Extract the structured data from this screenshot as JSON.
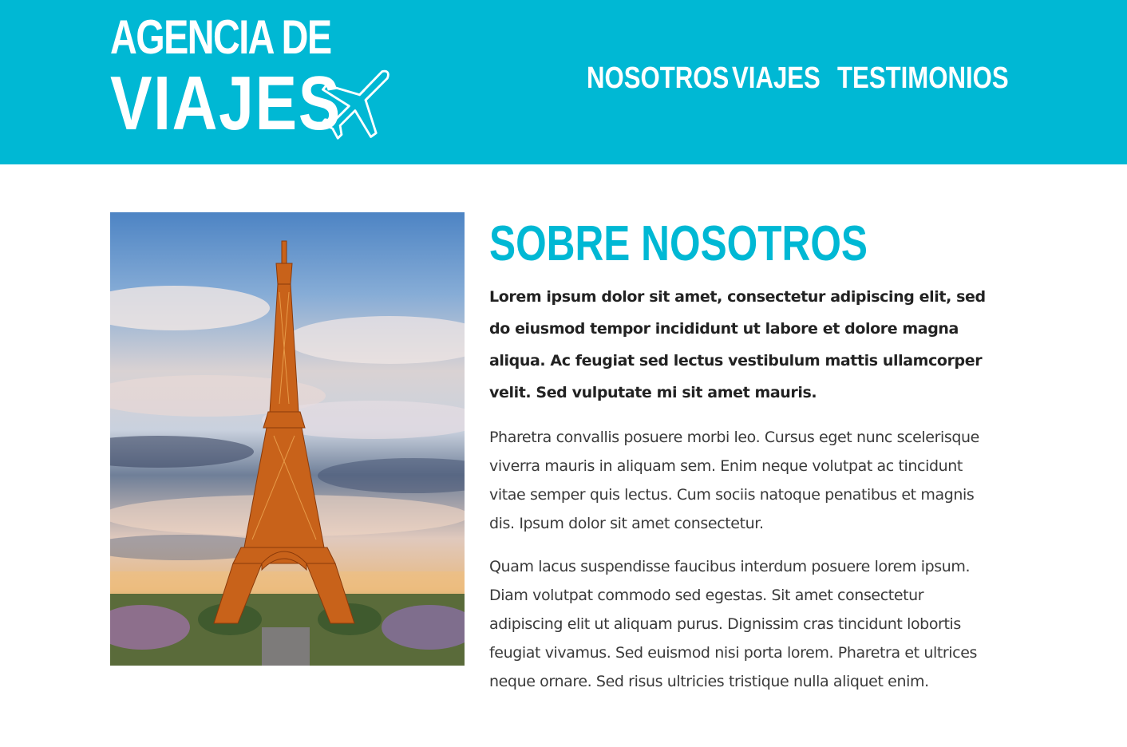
{
  "brand": {
    "line1": "AGENCIA DE",
    "line2": "VIAJES",
    "icon": "airplane-icon",
    "color": "#00b8d4"
  },
  "nav": {
    "items": [
      {
        "label": "NOSOTROS"
      },
      {
        "label": "VIAJES"
      },
      {
        "label": "TESTIMONIOS"
      }
    ]
  },
  "about": {
    "image": "eiffel-tower-photo",
    "title": "SOBRE NOSOTROS",
    "lead": "Lorem ipsum dolor sit amet, consectetur adipiscing elit, sed do eiusmod tempor incididunt ut labore et dolore magna aliqua. Ac feugiat sed lectus vestibulum mattis ullamcorper velit. Sed vulputate mi sit amet mauris.",
    "paragraphs": [
      "Pharetra convallis posuere morbi leo. Cursus eget nunc scelerisque viverra mauris in aliquam sem. Enim neque volutpat ac tincidunt vitae semper quis lectus. Cum sociis natoque penatibus et magnis dis. Ipsum dolor sit amet consectetur.",
      "Quam lacus suspendisse faucibus interdum posuere lorem ipsum. Diam volutpat commodo sed egestas. Sit amet consectetur adipiscing elit ut aliquam purus. Dignissim cras tincidunt lobortis feugiat vivamus. Sed euismod nisi porta lorem. Pharetra et ultrices neque ornare. Sed risus ultricies tristique nulla aliquet enim."
    ]
  }
}
